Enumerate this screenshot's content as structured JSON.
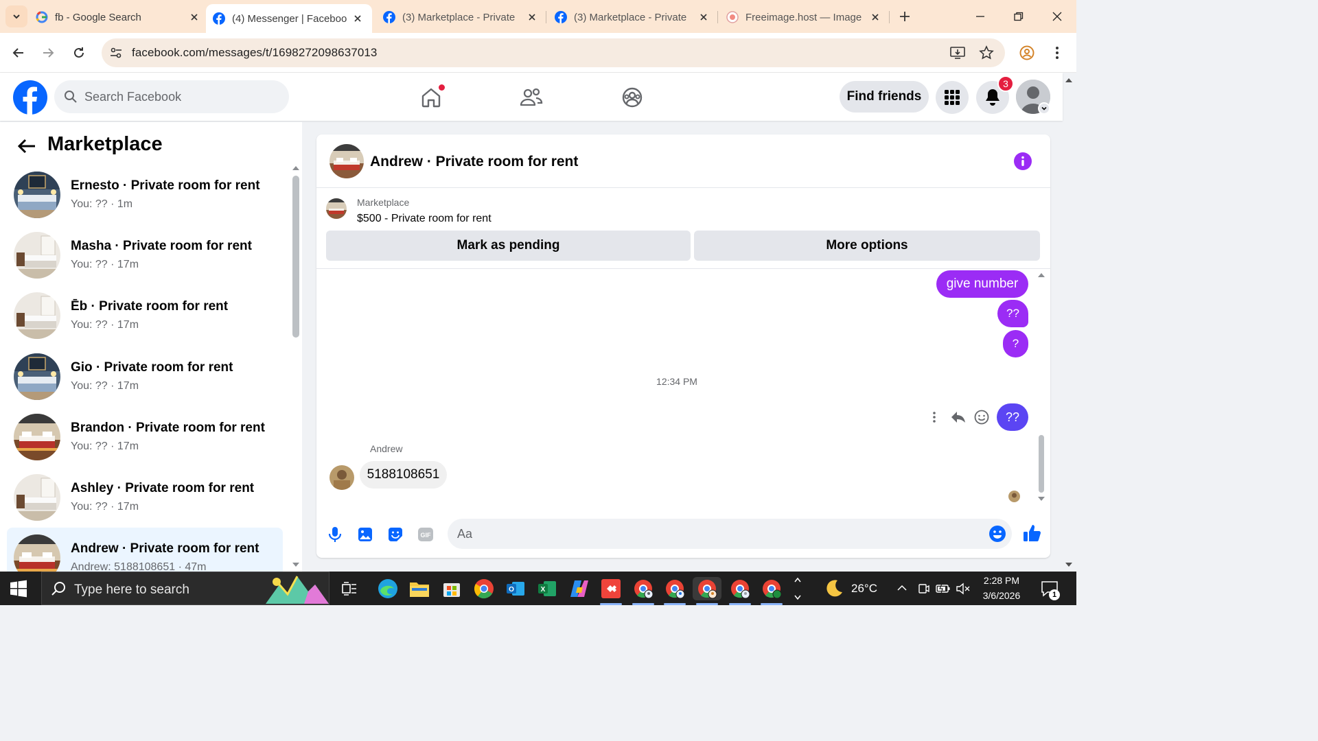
{
  "browser": {
    "tabs": [
      {
        "title": "fb - Google Search",
        "favicon": "google-icon",
        "active": false
      },
      {
        "title": "(4) Messenger | Facebook",
        "favicon": "facebook-icon",
        "active": true
      },
      {
        "title": "(3) Marketplace - Private",
        "favicon": "facebook-icon",
        "active": false
      },
      {
        "title": "(3) Marketplace - Private",
        "favicon": "facebook-icon",
        "active": false
      },
      {
        "title": "Freeimage.host — Image",
        "favicon": "freeimage-icon",
        "active": false
      }
    ],
    "url": "facebook.com/messages/t/1698272098637013"
  },
  "fb_header": {
    "search_placeholder": "Search Facebook",
    "find_friends": "Find friends",
    "notification_count": "3"
  },
  "sidebar": {
    "title": "Marketplace",
    "conversations": [
      {
        "name": "Ernesto · Private room for rent",
        "preview": "You: ?? · 1m",
        "photo": "room-blue"
      },
      {
        "name": "Masha · Private room for rent",
        "preview": "You: ?? · 17m",
        "photo": "room-white"
      },
      {
        "name": "Ēb · Private room for rent",
        "preview": "You: ?? · 17m",
        "photo": "room-white"
      },
      {
        "name": "Gio · Private room for rent",
        "preview": "You: ?? · 17m",
        "photo": "room-blue"
      },
      {
        "name": "Brandon · Private room for rent",
        "preview": "You: ?? · 17m",
        "photo": "room-wood"
      },
      {
        "name": "Ashley · Private room for rent",
        "preview": "You: ?? · 17m",
        "photo": "room-white"
      },
      {
        "name": "Andrew · Private room for rent",
        "preview": "Andrew: 5188108651 · 47m",
        "photo": "room-wood",
        "active": true
      }
    ]
  },
  "chat": {
    "title": "Andrew · Private room for rent",
    "listing": {
      "label": "Marketplace",
      "item": "$500 - Private room for rent",
      "mark_pending": "Mark as pending",
      "more_options": "More options"
    },
    "messages_out": [
      "give number",
      "??",
      "?"
    ],
    "timestamp": "12:34 PM",
    "last_out": "??",
    "sender": "Andrew",
    "incoming": "5188108651",
    "composer_placeholder": "Aa"
  },
  "taskbar": {
    "search_placeholder": "Type here to search",
    "temperature": "26°C",
    "time": "2:28 PM",
    "date": "3/6/2026",
    "notification_count": "1"
  },
  "colors": {
    "fb_blue": "#0866ff",
    "message_purple": "#9b2cf5",
    "message_blue": "#5b45f3",
    "notification_red": "#e41e3f"
  }
}
